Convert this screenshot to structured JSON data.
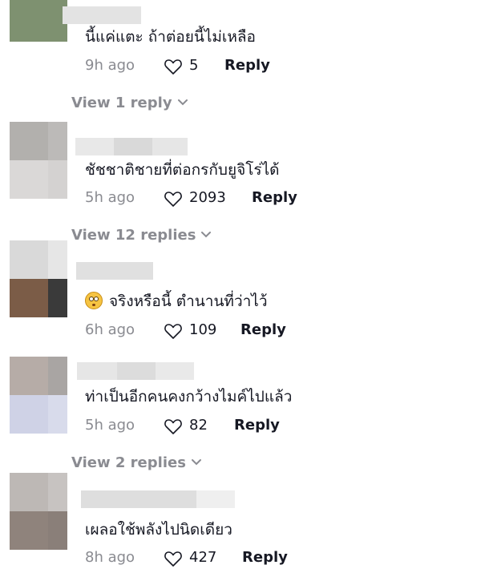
{
  "comments": [
    {
      "text": "นี้แค่แตะ ถ้าต่อยนี้ไม่เหลือ",
      "time": "9h ago",
      "likes": "5",
      "reply_label": "Reply",
      "avatar_colors": [
        "#7e9170",
        "#e9e9e9"
      ],
      "view_replies": "View 1 reply"
    },
    {
      "text": "ชัชชาติชายที่ต่อกรกับยูจิโร่ได้",
      "time": "5h ago",
      "likes": "2093",
      "reply_label": "Reply",
      "avatar_colors": [
        "#b2b0ad",
        "#dad8d7"
      ],
      "view_replies": "View 12 replies"
    },
    {
      "text": "จริงหรือนี้ ตำนานที่ว่าไว้",
      "has_emoji": true,
      "emoji_icon": "flushed-face-icon",
      "time": "6h ago",
      "likes": "109",
      "reply_label": "Reply",
      "avatar_colors": [
        "#d9d9d9",
        "#7b5c47",
        "#3a3a3a"
      ]
    },
    {
      "text": "ท่าเป็นอีกคนคงกว้างไมค์ไปแล้ว",
      "time": "5h ago",
      "likes": "82",
      "reply_label": "Reply",
      "avatar_colors": [
        "#b6aca7",
        "#cfd2e6"
      ],
      "view_replies": "View 2 replies"
    },
    {
      "text": "เผลอใช้พลังไปนิดเดียว",
      "time": "8h ago",
      "likes": "427",
      "reply_label": "Reply",
      "avatar_colors": [
        "#bdb8b5",
        "#8f837c"
      ]
    }
  ],
  "colors": {
    "text": "#161823",
    "muted": "#8a8b91",
    "placeholder_gray": "#e1e1e1"
  }
}
